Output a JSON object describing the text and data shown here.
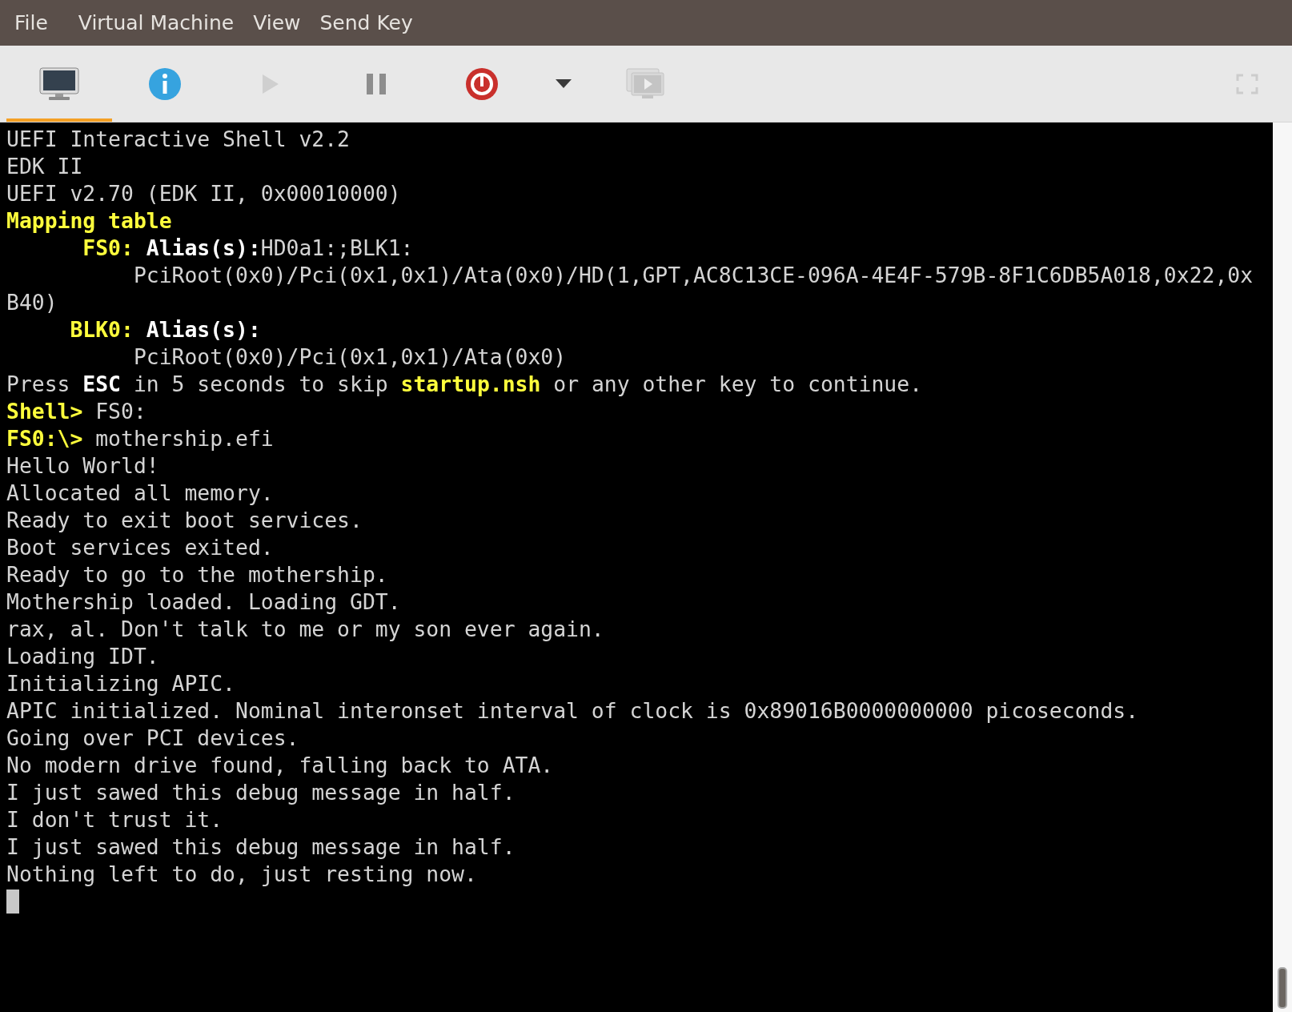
{
  "menu": [
    "File",
    "Virtual Machine",
    "View",
    "Send Key"
  ],
  "toolbar": [
    {
      "kind": "console",
      "selected": true,
      "disabled": false
    },
    {
      "kind": "info",
      "selected": false,
      "disabled": false
    },
    {
      "kind": "run",
      "selected": false,
      "disabled": true
    },
    {
      "kind": "pause",
      "selected": false,
      "disabled": false
    },
    {
      "kind": "power",
      "selected": false,
      "disabled": false
    },
    {
      "kind": "dropdown",
      "selected": false,
      "disabled": false
    },
    {
      "kind": "snapshots",
      "selected": false,
      "disabled": true
    },
    {
      "kind": "spacer"
    },
    {
      "kind": "fullscreen",
      "selected": false,
      "disabled": true
    }
  ],
  "console": {
    "lines": [
      [
        {
          "kind": "plain",
          "text": "UEFI Interactive Shell v2.2"
        }
      ],
      [
        {
          "kind": "plain",
          "text": "EDK II"
        }
      ],
      [
        {
          "kind": "plain",
          "text": "UEFI v2.70 (EDK II, 0x00010000)"
        }
      ],
      [
        {
          "kind": "accent",
          "text": "Mapping table"
        }
      ],
      [
        {
          "kind": "accent",
          "text": "      FS0: "
        },
        {
          "kind": "bold",
          "text": "Alias(s):"
        },
        {
          "kind": "plain",
          "text": "HD0a1:;BLK1:"
        }
      ],
      [
        {
          "kind": "plain",
          "text": "          PciRoot(0x0)/Pci(0x1,0x1)/Ata(0x0)/HD(1,GPT,AC8C13CE-096A-4E4F-579B-8F1C6DB5A018,0x22,0x"
        }
      ],
      [
        {
          "kind": "plain",
          "text": "B40)"
        }
      ],
      [
        {
          "kind": "accent",
          "text": "     BLK0: "
        },
        {
          "kind": "bold",
          "text": "Alias(s):"
        }
      ],
      [
        {
          "kind": "plain",
          "text": "          PciRoot(0x0)/Pci(0x1,0x1)/Ata(0x0)"
        }
      ],
      [
        {
          "kind": "plain",
          "text": "Press "
        },
        {
          "kind": "bold",
          "text": "ESC"
        },
        {
          "kind": "plain",
          "text": " in 5 seconds to skip "
        },
        {
          "kind": "accent",
          "text": "startup.nsh"
        },
        {
          "kind": "plain",
          "text": " or any other key to continue."
        }
      ],
      [
        {
          "kind": "accent",
          "text": "Shell> "
        },
        {
          "kind": "plain",
          "text": "FS0:"
        }
      ],
      [
        {
          "kind": "accent",
          "text": "FS0:\\> "
        },
        {
          "kind": "plain",
          "text": "mothership.efi"
        }
      ],
      [
        {
          "kind": "plain",
          "text": "Hello World!"
        }
      ],
      [
        {
          "kind": "plain",
          "text": "Allocated all memory."
        }
      ],
      [
        {
          "kind": "plain",
          "text": "Ready to exit boot services."
        }
      ],
      [
        {
          "kind": "plain",
          "text": "Boot services exited."
        }
      ],
      [
        {
          "kind": "plain",
          "text": "Ready to go to the mothership."
        }
      ],
      [
        {
          "kind": "plain",
          "text": "Mothership loaded. Loading GDT."
        }
      ],
      [
        {
          "kind": "plain",
          "text": "rax, al. Don't talk to me or my son ever again."
        }
      ],
      [
        {
          "kind": "plain",
          "text": "Loading IDT."
        }
      ],
      [
        {
          "kind": "plain",
          "text": "Initializing APIC."
        }
      ],
      [
        {
          "kind": "plain",
          "text": "APIC initialized. Nominal interonset interval of clock is 0x89016B0000000000 picoseconds."
        }
      ],
      [
        {
          "kind": "plain",
          "text": "Going over PCI devices."
        }
      ],
      [
        {
          "kind": "plain",
          "text": "No modern drive found, falling back to ATA."
        }
      ],
      [
        {
          "kind": "plain",
          "text": "I just sawed this debug message in half."
        }
      ],
      [
        {
          "kind": "plain",
          "text": "I don't trust it."
        }
      ],
      [
        {
          "kind": "plain",
          "text": "I just sawed this debug message in half."
        }
      ],
      [
        {
          "kind": "plain",
          "text": "Nothing left to do, just resting now."
        }
      ]
    ]
  }
}
